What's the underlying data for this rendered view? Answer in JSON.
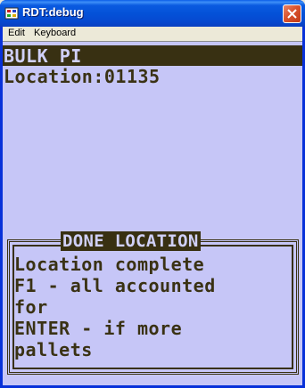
{
  "window": {
    "title": "RDT:debug"
  },
  "menubar": {
    "items": [
      "Edit",
      "Keyboard"
    ]
  },
  "screen": {
    "header": "BULK PI",
    "location_line": "Location:01135"
  },
  "dialog": {
    "title": "DONE LOCATION",
    "lines": [
      "Location complete",
      "F1 - all accounted",
      "for",
      "ENTER - if more",
      "pallets"
    ]
  },
  "colors": {
    "screen_background": "#c6c6f7",
    "text_dark": "#3a3214",
    "highlight_bar": "#383012",
    "highlight_text": "#d0d0f8"
  },
  "icons": {
    "app": "app-icon",
    "close": "close-icon"
  }
}
